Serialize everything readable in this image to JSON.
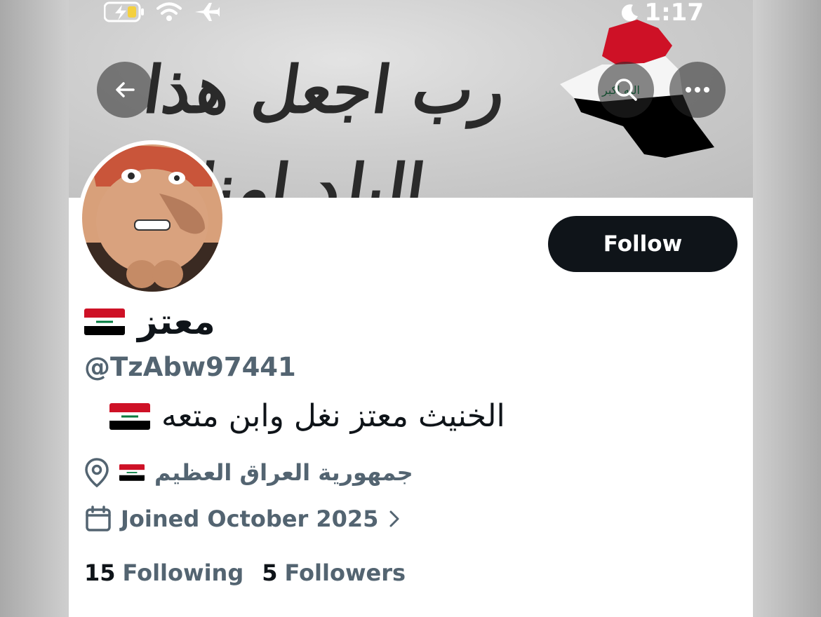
{
  "status_bar": {
    "time": "1:17"
  },
  "banner": {
    "calligraphy": "رب اجعل هذا البلد امنا"
  },
  "profile": {
    "display_name": "معتز",
    "handle": "@TzAbw97441",
    "bio": "الخنيث  معتز نغل وابن متعه",
    "location": "جمهورية العراق العظيم",
    "joined": "Joined October 2025",
    "following_count": "15",
    "following_label": "Following",
    "followers_count": "5",
    "followers_label": "Followers"
  },
  "actions": {
    "follow_label": "Follow"
  },
  "icons": {
    "back": "back-arrow-icon",
    "search": "search-icon",
    "more": "more-icon",
    "location": "location-pin-icon",
    "calendar": "calendar-icon",
    "chevron": "chevron-right-icon",
    "flag": "iraq-flag-icon"
  },
  "colors": {
    "follow_bg": "#0f1419",
    "secondary_text": "#536471",
    "primary_text": "#0f1419",
    "flag_red": "#ce1126",
    "flag_white": "#ffffff",
    "flag_black": "#000000",
    "flag_green": "#007a3d"
  }
}
